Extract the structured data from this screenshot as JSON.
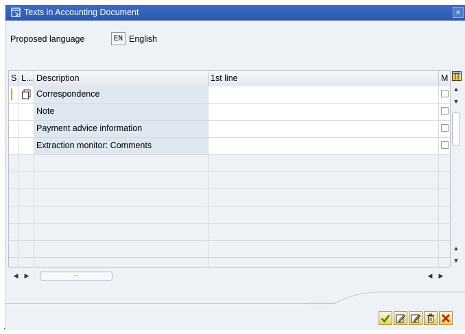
{
  "window": {
    "title": "Texts in Accounting Document",
    "close_label": "×"
  },
  "language": {
    "label": "Proposed language",
    "code": "EN",
    "name": "English"
  },
  "table": {
    "headers": [
      "S",
      "L...",
      "Description",
      "1st line",
      "M"
    ],
    "rows": [
      {
        "description": "Correspondence",
        "first_line": "",
        "has_doc_icon": true,
        "selected": true
      },
      {
        "description": "Note",
        "first_line": "",
        "has_doc_icon": false,
        "selected": false
      },
      {
        "description": "Payment advice information",
        "first_line": "",
        "has_doc_icon": false,
        "selected": false
      },
      {
        "description": "Extraction monitor: Comments",
        "first_line": "",
        "has_doc_icon": false,
        "selected": false
      }
    ],
    "empty_row_count": 7
  },
  "toolbar": {
    "buttons": [
      "confirm-icon",
      "edit-icon",
      "edit-alt-icon",
      "delete-icon",
      "cancel-icon"
    ]
  },
  "colors": {
    "title_bar": "#2a57b0",
    "description_column": "#dfe8f1",
    "button_fill": "#f2cf52",
    "confirm": "#2e8b1f",
    "cancel": "#d21a1a"
  }
}
